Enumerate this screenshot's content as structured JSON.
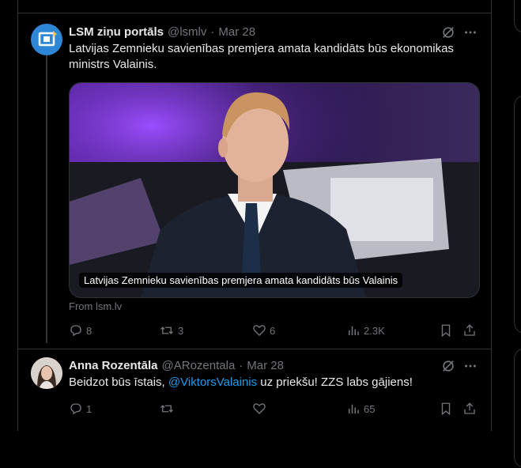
{
  "tweet1": {
    "name": "LSM ziņu portāls",
    "handle": "@lsmlv",
    "dot": "·",
    "date": "Mar 28",
    "text": "Latvijas Zemnieku savienības premjera amata kandidāts būs ekonomikas ministrs Valainis.",
    "image_caption": "Latvijas Zemnieku savienības premjera amata kandidāts būs Valainis",
    "source": "From lsm.lv",
    "stats": {
      "replies": "8",
      "reposts": "3",
      "likes": "6",
      "views": "2.3K"
    }
  },
  "tweet2": {
    "name": "Anna Rozentāla",
    "handle": "@ARozentala",
    "dot": "·",
    "date": "Mar 28",
    "text_before": "Beidzot būs īstais, ",
    "mention": "@ViktorsValainis",
    "text_after": " uz priekšu! ZZS labs gājiens!",
    "stats": {
      "replies": "1",
      "reposts": "",
      "likes": "",
      "views": "65"
    }
  },
  "colors": {
    "accent": "#1d9bf0",
    "muted": "#71767b",
    "text": "#e7e9ea",
    "bg": "#000000"
  }
}
